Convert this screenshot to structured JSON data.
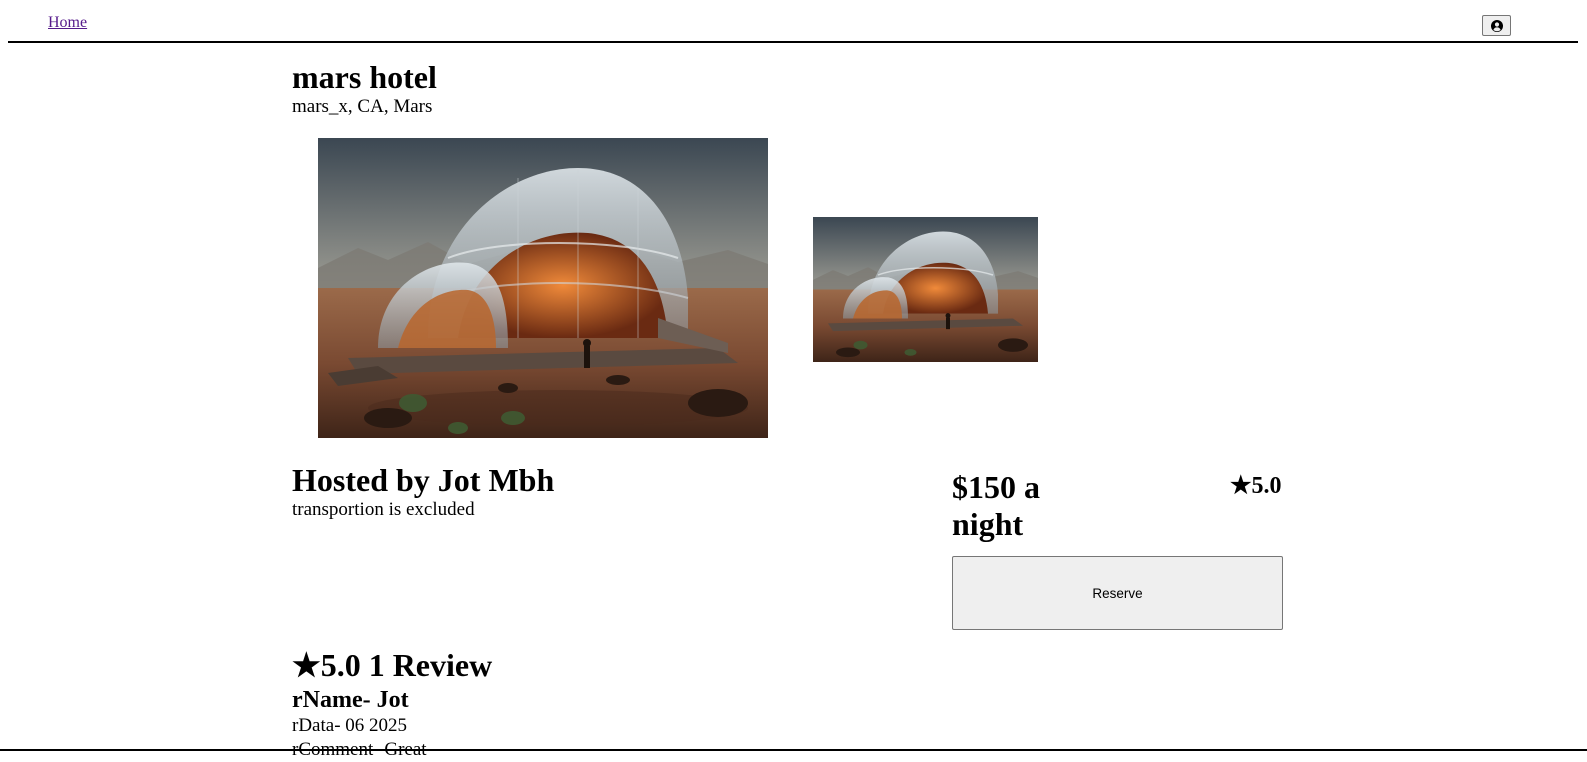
{
  "nav": {
    "home_label": "Home",
    "profile_icon": "user-circle-icon"
  },
  "spot": {
    "name": "mars hotel",
    "location": "mars_x, CA, Mars",
    "images": [
      {
        "alt": "mars hotel",
        "kind": "main"
      },
      {
        "alt": "mars hotel",
        "kind": "thumbnail"
      }
    ]
  },
  "host": {
    "title": "Hosted by Jot Mbh",
    "description": "transportion is excluded"
  },
  "booking": {
    "price": "$150 a night",
    "rating": "★5.0",
    "reserve_label": "Reserve"
  },
  "reviews": {
    "heading": "★5.0 1 Review",
    "items": [
      {
        "name": "rName- Jot",
        "date": "rData- 06 2025",
        "comment": "rComment- Great"
      }
    ]
  },
  "colors": {
    "link_visited": "#551a8b",
    "button_bg": "#efefef",
    "button_border": "#767676"
  }
}
